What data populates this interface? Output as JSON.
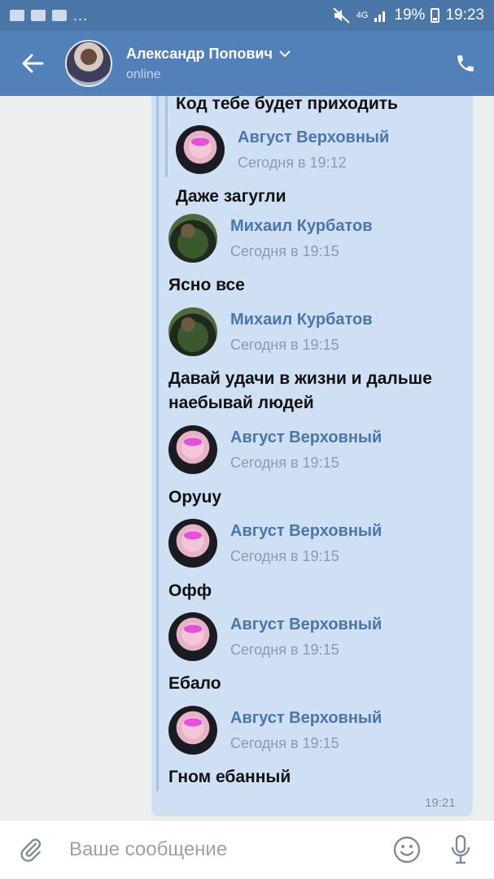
{
  "status_bar": {
    "network": "4G",
    "battery": "19%",
    "time": "19:23",
    "more": "..."
  },
  "header": {
    "contact_name": "Александр Попович",
    "contact_status": "online"
  },
  "messages": {
    "m0_text": "Код тебе будет приходить",
    "m1_author": "Август Верховный",
    "m1_date": "Сегодня в 19:12",
    "m1_text": "Даже загугли",
    "m2_author": "Михаил Курбатов",
    "m2_date": "Сегодня в 19:15",
    "m2_text": "Ясно все",
    "m3_author": "Михаил Курбатов",
    "m3_date": "Сегодня в 19:15",
    "m3_text_line1": "Давай удачи в жизни и дальше",
    "m3_text_line2": "наебывай людей",
    "m4_author": "Август Верховный",
    "m4_date": "Сегодня в 19:15",
    "m4_text": "Оруuу",
    "m5_author": "Август Верховный",
    "m5_date": "Сегодня в 19:15",
    "m5_text": "Офф",
    "m6_author": "Август Верховный",
    "m6_date": "Сегодня в 19:15",
    "m6_text": "Ебало",
    "m7_author": "Август Верховный",
    "m7_date": "Сегодня в 19:15",
    "m7_text": "Гном ебанный",
    "bubble_time": "19:21"
  },
  "input": {
    "placeholder": "Ваше сообщение"
  }
}
